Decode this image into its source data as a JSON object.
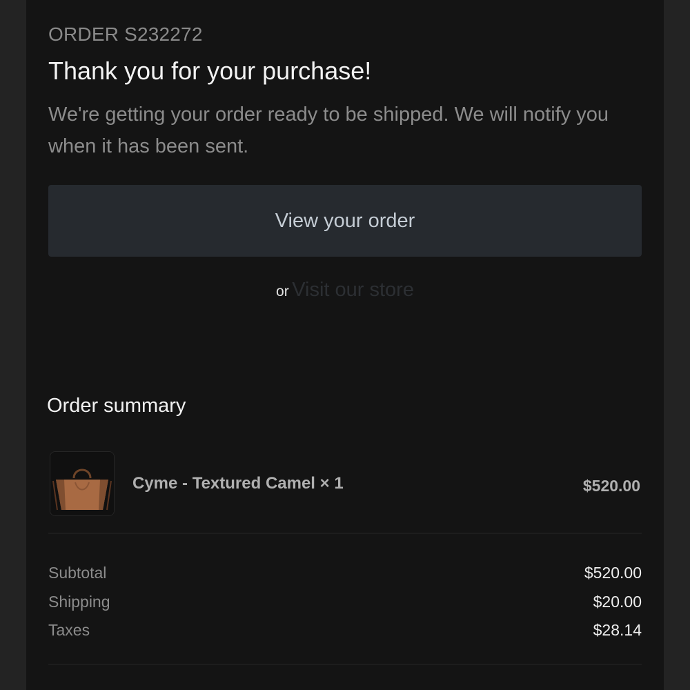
{
  "order": {
    "number_label": "ORDER S232272",
    "title": "Thank you for your purchase!",
    "message": "We're getting your order ready to be shipped. We will notify you when it has been sent."
  },
  "actions": {
    "view_order_label": "View your order",
    "or_label": "or",
    "visit_store_label": "Visit our store"
  },
  "summary": {
    "title": "Order summary",
    "items": [
      {
        "name": "Cyme - Textured Camel × 1",
        "price": "$520.00",
        "image_icon": "camel-handbag-thumbnail"
      }
    ],
    "totals": [
      {
        "label": "Subtotal",
        "value": "$520.00"
      },
      {
        "label": "Shipping",
        "value": "$20.00"
      },
      {
        "label": "Taxes",
        "value": "$28.14"
      }
    ]
  },
  "colors": {
    "background": "#141414",
    "outer": "#232323",
    "button_bg": "#262a2f",
    "button_text": "#c4ccd4",
    "product_tan": "#a86a43"
  }
}
